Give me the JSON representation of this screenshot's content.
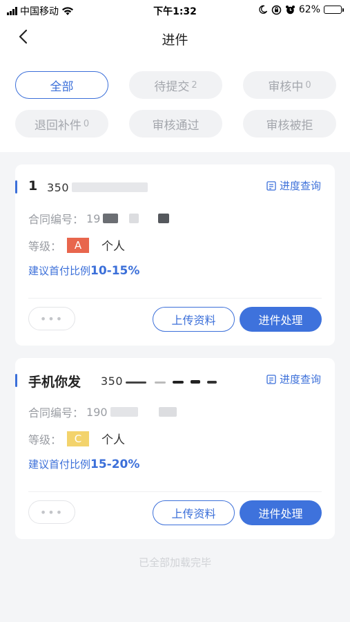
{
  "status_bar": {
    "carrier": "中国移动",
    "time": "下午1:32",
    "battery": "62%",
    "battery_level": 0.62
  },
  "nav": {
    "title": "进件",
    "back_icon": "chevron-left-icon"
  },
  "tabs": [
    {
      "label": "全部",
      "count": "",
      "active": true
    },
    {
      "label": "待提交",
      "count": "2",
      "active": false
    },
    {
      "label": "审核中",
      "count": "0",
      "active": false
    },
    {
      "label": "退回补件",
      "count": "0",
      "active": false
    },
    {
      "label": "审核通过",
      "count": "",
      "active": false
    },
    {
      "label": "审核被拒",
      "count": "",
      "active": false
    }
  ],
  "cards": [
    {
      "name": "1",
      "phone": "350",
      "progress_label": "进度查询",
      "contract_label": "合同编号：",
      "contract_value": "19",
      "grade_label": "等级：",
      "grade": "A",
      "grade_color": "#e8664d",
      "customer_type": "个人",
      "ratio_label": "建议首付比例",
      "ratio_value": "10-15%",
      "more_label": "•••",
      "upload_label": "上传资料",
      "process_label": "进件处理"
    },
    {
      "name": "手机你发",
      "phone": "350",
      "progress_label": "进度查询",
      "contract_label": "合同编号：",
      "contract_value": "190",
      "grade_label": "等级：",
      "grade": "C",
      "grade_color": "#f3d36c",
      "customer_type": "个人",
      "ratio_label": "建议首付比例",
      "ratio_value": "15-20%",
      "more_label": "•••",
      "upload_label": "上传资料",
      "process_label": "进件处理"
    }
  ],
  "footer": {
    "text": "已全部加载完毕"
  }
}
